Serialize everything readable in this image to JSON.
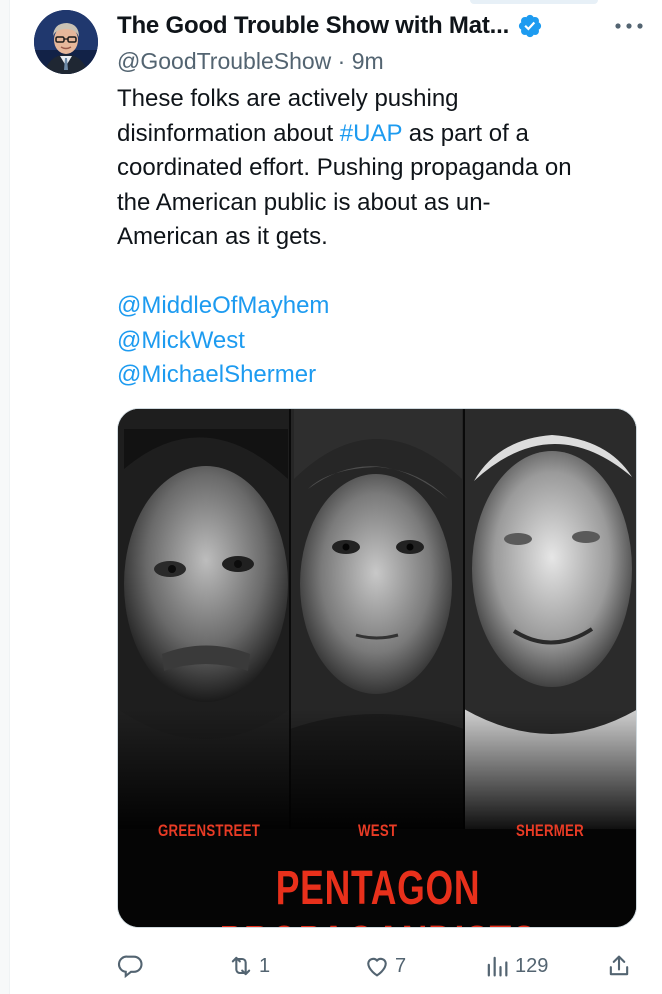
{
  "tweet": {
    "author": {
      "display_name": "The Good Trouble Show with Mat...",
      "handle": "@GoodTroubleShow",
      "time": "· 9m"
    },
    "text_lines": [
      "These folks are actively pushing",
      "disinformation about ",
      "#UAP",
      " as part of a",
      "coordinated effort. Pushing propaganda on",
      "the American public is about as un-",
      "American as it gets."
    ],
    "mentions": [
      "@MiddleOfMayhem",
      "@MickWest",
      "@MichaelShermer"
    ],
    "media": {
      "names": [
        "GREENSTREET",
        "WEST",
        "SHERMER"
      ],
      "title": "PENTAGON PROPAGANDISTS"
    },
    "metrics": {
      "retweets": "1",
      "likes": "7",
      "views": "129"
    }
  },
  "colors": {
    "link": "#1d9bf0",
    "muted": "#536471",
    "poster_red": "#e8301b",
    "verified": "#1d9bf0"
  },
  "icons": [
    "more-icon",
    "verified-badge-icon",
    "reply-icon",
    "retweet-icon",
    "like-icon",
    "views-icon",
    "share-icon"
  ]
}
